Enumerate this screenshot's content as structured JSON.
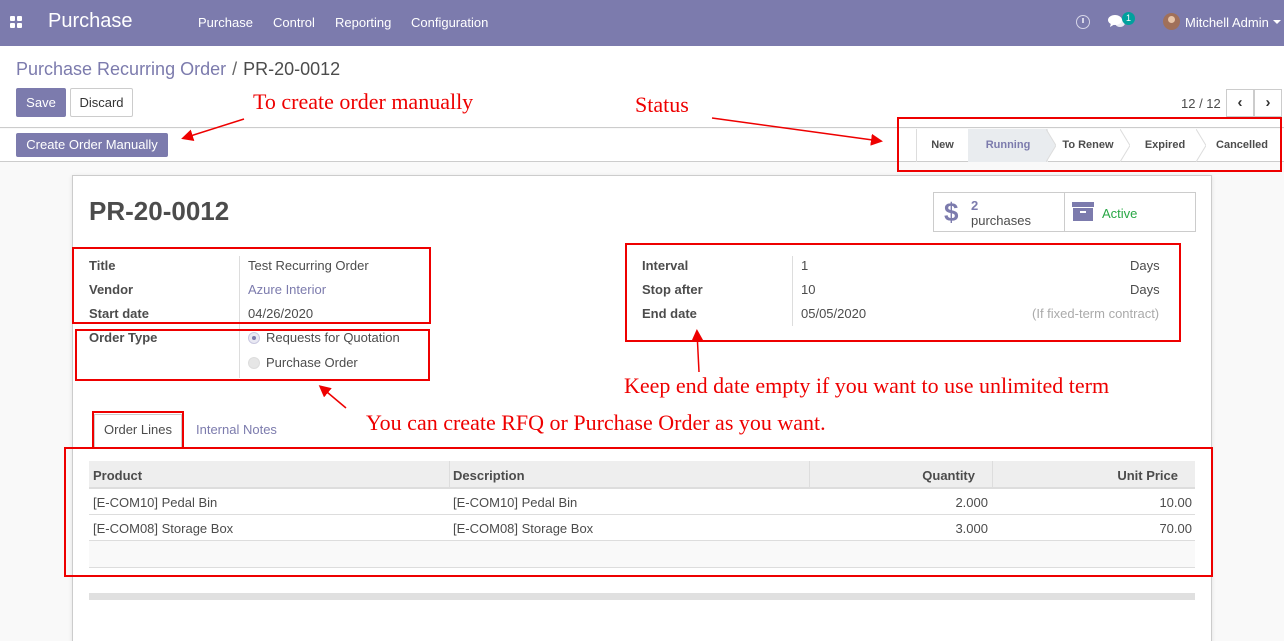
{
  "navbar": {
    "brand": "Purchase",
    "menu": [
      "Purchase",
      "Control",
      "Reporting",
      "Configuration"
    ],
    "message_count": "1",
    "user_name": "Mitchell Admin",
    "icons": [
      "apps-icon",
      "clock-icon",
      "chat-icon",
      "avatar",
      "caret-down-icon"
    ]
  },
  "breadcrumb": {
    "parent": "Purchase Recurring Order",
    "separator": "/",
    "current": "PR-20-0012"
  },
  "buttons": {
    "save": "Save",
    "discard": "Discard",
    "create_order_manually": "Create Order Manually"
  },
  "pager": {
    "value": "12 / 12",
    "prev": "‹",
    "next": "›"
  },
  "statusbar": {
    "steps": [
      "New",
      "Running",
      "To Renew",
      "Expired",
      "Cancelled"
    ],
    "active": "Running"
  },
  "record": {
    "name": "PR-20-0012"
  },
  "smart_buttons": {
    "purchases_count": "2",
    "purchases_label": "purchases",
    "active_label": "Active"
  },
  "fields_left": {
    "title_label": "Title",
    "title_value": "Test Recurring Order",
    "vendor_label": "Vendor",
    "vendor_value": "Azure Interior",
    "start_date_label": "Start date",
    "start_date_value": "04/26/2020",
    "order_type_label": "Order Type",
    "order_type_options": [
      "Requests for Quotation",
      "Purchase Order"
    ],
    "order_type_selected": "Requests for Quotation"
  },
  "fields_right": {
    "interval_label": "Interval",
    "interval_value": "1",
    "interval_unit": "Days",
    "stop_after_label": "Stop after",
    "stop_after_value": "10",
    "stop_after_unit": "Days",
    "end_date_label": "End date",
    "end_date_value": "05/05/2020",
    "end_date_hint": "(If fixed-term contract)"
  },
  "tabs": [
    "Order Lines",
    "Internal Notes"
  ],
  "order_lines": {
    "columns": [
      "Product",
      "Description",
      "Quantity",
      "Unit Price"
    ],
    "rows": [
      [
        "[E-COM10] Pedal Bin",
        "[E-COM10] Pedal Bin",
        "2.000",
        "10.00"
      ],
      [
        "[E-COM08] Storage Box",
        "[E-COM08] Storage Box",
        "3.000",
        "70.00"
      ]
    ]
  },
  "annotations": {
    "manual": "To create order manually",
    "status": "Status",
    "end_date": "Keep end date empty if you want to use unlimited term",
    "order_type": "You can create RFQ or Purchase Order as you want."
  },
  "colors": {
    "brand": "#7c7bad",
    "annotation": "#e00000",
    "active": "#28a745"
  }
}
